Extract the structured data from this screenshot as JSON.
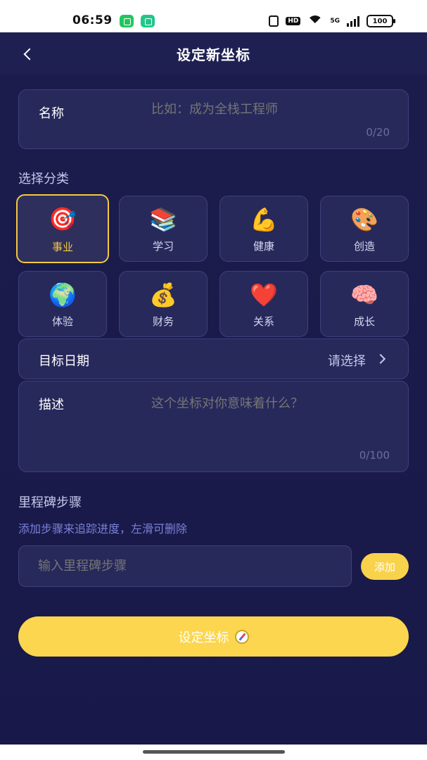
{
  "status_bar": {
    "time": "06:59",
    "hd_label": "HD",
    "network_label": "5G",
    "battery": "100"
  },
  "nav": {
    "title": "设定新坐标",
    "back_icon": "chevron-left-icon"
  },
  "name_field": {
    "label": "名称",
    "placeholder": "比如：成为全栈工程师",
    "counter": "0/20"
  },
  "category": {
    "label": "选择分类",
    "items": [
      {
        "emoji": "🎯",
        "label": "事业",
        "selected": true
      },
      {
        "emoji": "📚",
        "label": "学习",
        "selected": false
      },
      {
        "emoji": "💪",
        "label": "健康",
        "selected": false
      },
      {
        "emoji": "🎨",
        "label": "创造",
        "selected": false
      },
      {
        "emoji": "🌍",
        "label": "体验",
        "selected": false
      },
      {
        "emoji": "💰",
        "label": "财务",
        "selected": false
      },
      {
        "emoji": "❤️",
        "label": "关系",
        "selected": false
      },
      {
        "emoji": "🧠",
        "label": "成长",
        "selected": false
      }
    ]
  },
  "date_field": {
    "label": "目标日期",
    "value": "请选择"
  },
  "description_field": {
    "label": "描述",
    "placeholder": "这个坐标对你意味着什么？",
    "counter": "0/100"
  },
  "milestones": {
    "title": "里程碑步骤",
    "hint": "添加步骤来追踪进度，左滑可删除",
    "input_placeholder": "输入里程碑步骤",
    "add_label": "添加"
  },
  "submit": {
    "label": "设定坐标"
  },
  "colors": {
    "background": "#1b1c4c",
    "card": "#27295b",
    "accent": "#f9d24c",
    "placeholder": "#7a80d6"
  }
}
